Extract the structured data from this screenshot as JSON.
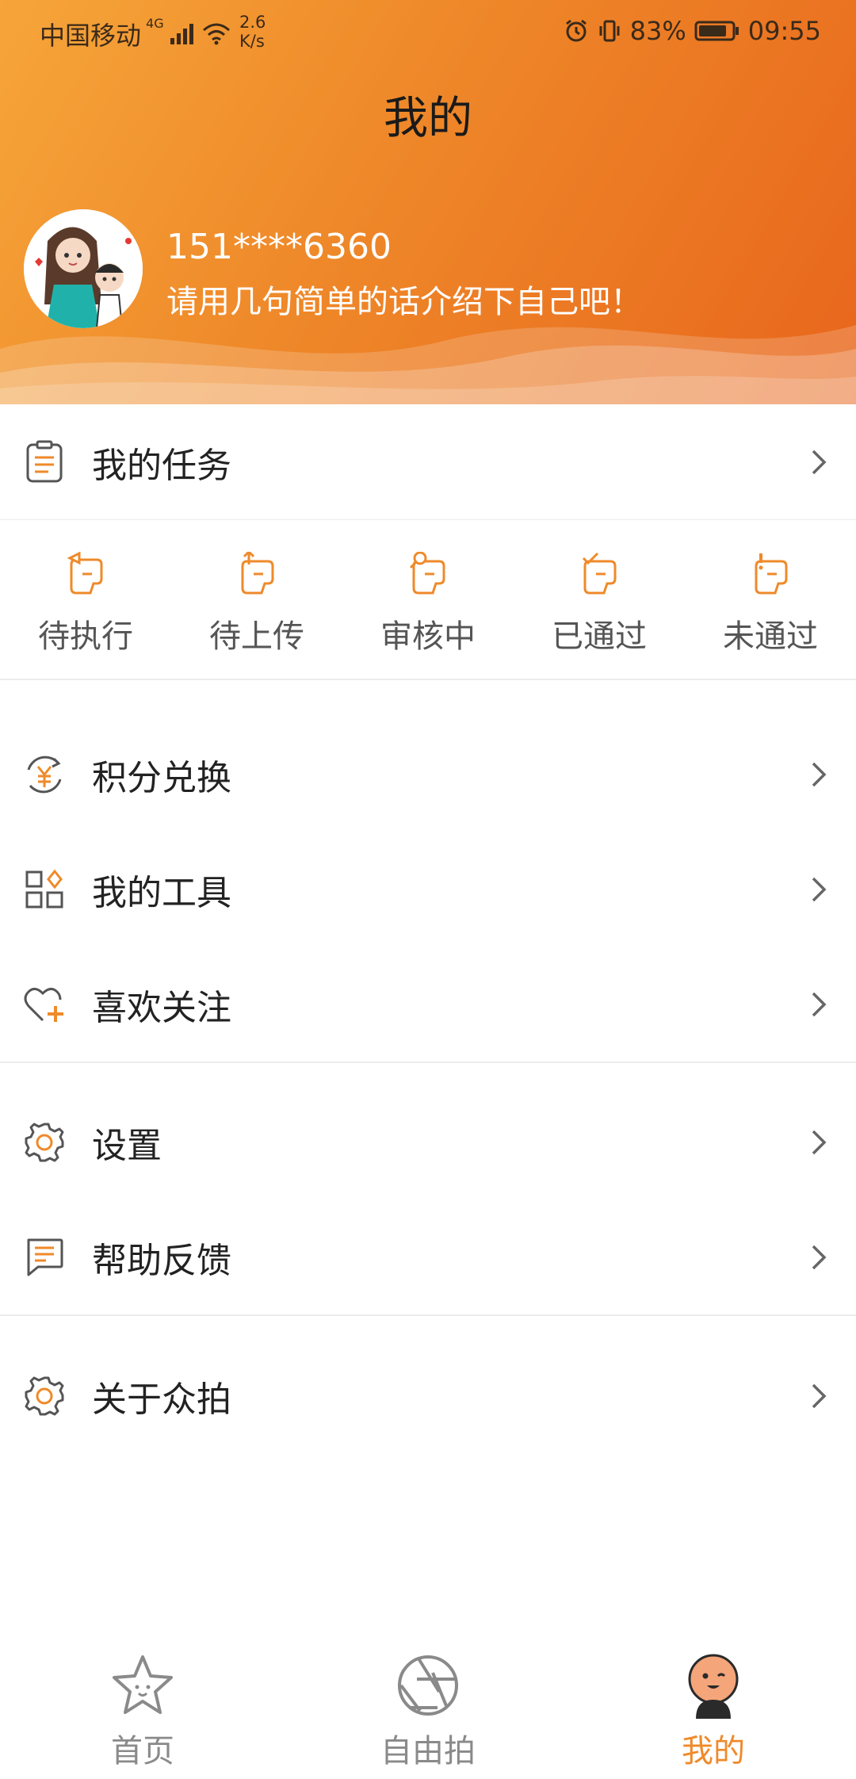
{
  "status_bar": {
    "carrier": "中国移动",
    "network": "4G",
    "speed_value": "2.6",
    "speed_unit": "K/s",
    "battery": "83%",
    "time": "09:55"
  },
  "header": {
    "title": "我的"
  },
  "profile": {
    "phone": "151****6360",
    "bio": "请用几句简单的话介绍下自己吧！"
  },
  "menu": {
    "my_tasks": "我的任务",
    "points_exchange": "积分兑换",
    "my_tools": "我的工具",
    "favorites": "喜欢关注",
    "settings": "设置",
    "help_feedback": "帮助反馈",
    "about": "关于众拍"
  },
  "task_status": [
    {
      "label": "待执行"
    },
    {
      "label": "待上传"
    },
    {
      "label": "审核中"
    },
    {
      "label": "已通过"
    },
    {
      "label": "未通过"
    }
  ],
  "bottom_nav": [
    {
      "label": "首页",
      "active": false
    },
    {
      "label": "自由拍",
      "active": false
    },
    {
      "label": "我的",
      "active": true
    }
  ],
  "colors": {
    "accent": "#ef8a2a",
    "header_start": "#f6a53a",
    "header_end": "#e8661c"
  }
}
